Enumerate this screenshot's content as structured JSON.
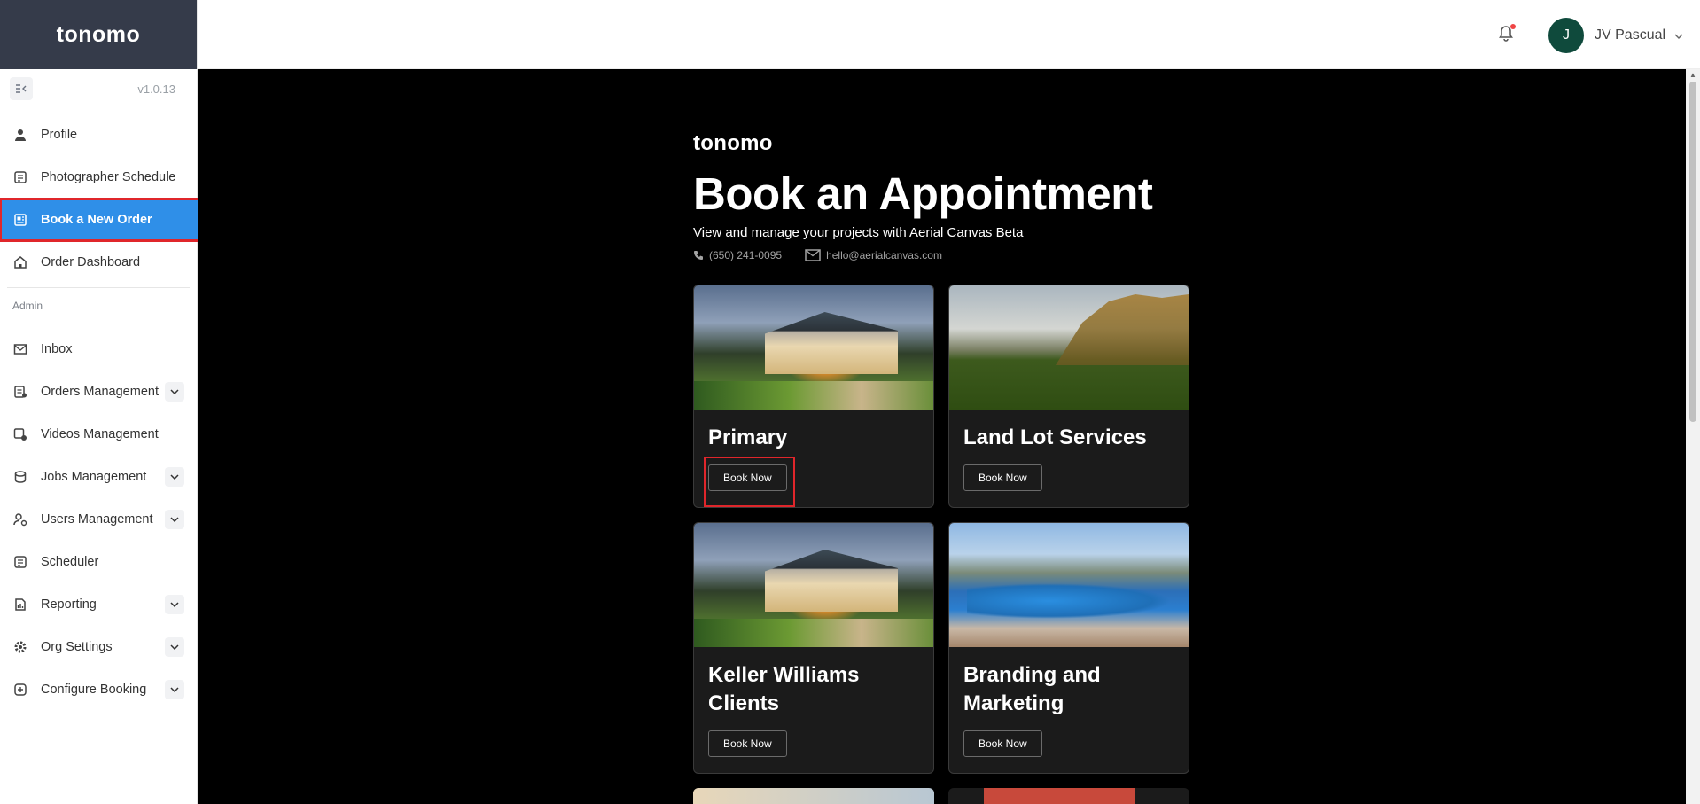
{
  "brand": "tonomo",
  "version": "v1.0.13",
  "sidebar": {
    "items": [
      {
        "label": "Profile"
      },
      {
        "label": "Photographer Schedule"
      },
      {
        "label": "Book a New Order"
      },
      {
        "label": "Order Dashboard"
      }
    ],
    "section_label": "Admin",
    "admin_items": [
      {
        "label": "Inbox"
      },
      {
        "label": "Orders Management"
      },
      {
        "label": "Videos Management"
      },
      {
        "label": "Jobs Management"
      },
      {
        "label": "Users Management"
      },
      {
        "label": "Scheduler"
      },
      {
        "label": "Reporting"
      },
      {
        "label": "Org Settings"
      },
      {
        "label": "Configure Booking"
      }
    ]
  },
  "header": {
    "user_initial": "J",
    "user_name": "JV Pascual"
  },
  "booking": {
    "logo": "tonomo",
    "title": "Book an Appointment",
    "subtitle": "View and manage your projects with Aerial Canvas Beta",
    "phone": "(650) 241-0095",
    "email": "hello@aerialcanvas.com",
    "cards": [
      {
        "title": "Primary",
        "button": "Book Now"
      },
      {
        "title": "Land Lot Services",
        "button": "Book Now"
      },
      {
        "title": "Keller Williams Clients",
        "button": "Book Now"
      },
      {
        "title": "Branding and Marketing",
        "button": "Book Now"
      }
    ]
  },
  "colors": {
    "sidebar_brand_bg": "#353b4a",
    "active_item": "#2f8fe8",
    "highlight": "#e0262b",
    "avatar": "#0f4a3c",
    "main_bg": "#000000"
  }
}
